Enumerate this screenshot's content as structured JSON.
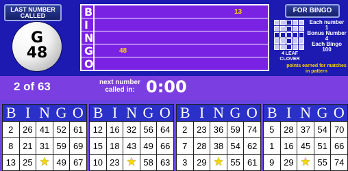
{
  "last_number_label": "LAST NUMBER CALLED",
  "ball": {
    "letter": "G",
    "number": "48"
  },
  "board": {
    "rows": [
      {
        "letter": "B",
        "numbers": [
          {
            "value": "13",
            "left": 0
          }
        ]
      },
      {
        "letter": "I",
        "numbers": []
      },
      {
        "letter": "N",
        "numbers": []
      },
      {
        "letter": "G",
        "numbers": [
          {
            "value": "48",
            "left": 0
          }
        ]
      },
      {
        "letter": "O",
        "numbers": []
      }
    ]
  },
  "for_bingo_button": "FOR BINGO",
  "pattern_label": "4 LEAF CLOVER",
  "points": {
    "each_number_label": "Each number",
    "each_number_value": "1",
    "bonus_label": "Bonus Number",
    "bonus_value": "4",
    "each_bingo_label": "Each Bingo",
    "each_bingo_value": "100"
  },
  "points_note": "points earned for matches in pattern",
  "status": {
    "count": "2 of 63",
    "next_label": "next number called in:",
    "timer": "0:00"
  },
  "card_header_letters": [
    "B",
    "I",
    "N",
    "G",
    "O"
  ],
  "cards": [
    {
      "rows": [
        [
          "2",
          "26",
          "41",
          "52",
          "61"
        ],
        [
          "8",
          "21",
          "31",
          "59",
          "69"
        ],
        [
          "13",
          "25",
          "★",
          "49",
          "67"
        ]
      ]
    },
    {
      "rows": [
        [
          "12",
          "16",
          "32",
          "56",
          "64"
        ],
        [
          "15",
          "18",
          "43",
          "49",
          "66"
        ],
        [
          "10",
          "23",
          "★",
          "58",
          "63"
        ]
      ]
    },
    {
      "rows": [
        [
          "2",
          "23",
          "36",
          "59",
          "74"
        ],
        [
          "7",
          "28",
          "38",
          "54",
          "62"
        ],
        [
          "3",
          "29",
          "★",
          "55",
          "61"
        ]
      ]
    },
    {
      "rows": [
        [
          "5",
          "28",
          "37",
          "54",
          "70"
        ],
        [
          "1",
          "16",
          "45",
          "51",
          "66"
        ],
        [
          "9",
          "29",
          "★",
          "55",
          "74"
        ]
      ]
    }
  ]
}
